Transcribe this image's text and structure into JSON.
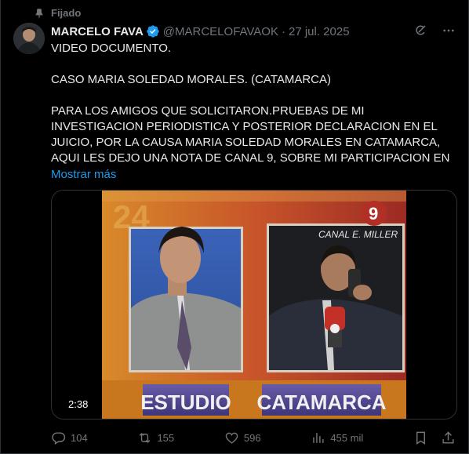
{
  "pinned_label": "Fijado",
  "author": {
    "name": "MARCELO FAVA",
    "handle": "@MARCELOFAVAOK",
    "separator": "·",
    "date": "27 jul. 2025"
  },
  "post": {
    "line1": "VIDEO DOCUMENTO.",
    "line2": "CASO MARIA SOLEDAD MORALES. (CATAMARCA)",
    "line3": "PARA LOS AMIGOS QUE SOLICITARON.PRUEBAS DE MI INVESTIGACION PERIODISTICA Y POSTERIOR DECLARACION EN EL JUICIO, POR LA CAUSA MARIA SOLEDAD MORALES EN CATAMARCA, AQUI LES DEJO UNA NOTA DE CANAL 9, SOBRE MI PARTICIPACION EN",
    "show_more": "Mostrar más"
  },
  "video": {
    "duration": "2:38",
    "left_caption": "ESTUDIO",
    "right_caption": "CATAMARCA",
    "overlay_text": "CANAL E. MILLER",
    "channel_number": "9",
    "background_number": "24"
  },
  "stats": {
    "replies": "104",
    "reposts": "155",
    "likes": "596",
    "views": "455 mil"
  },
  "colors": {
    "accent": "#1d9bf0",
    "muted": "#71767b",
    "text": "#e7e9ea",
    "background": "#000000"
  }
}
